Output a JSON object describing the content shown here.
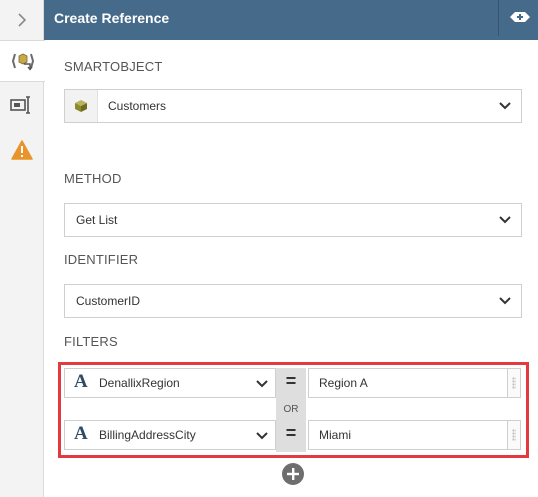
{
  "header": {
    "title": "Create Reference"
  },
  "rail": {
    "items": [
      {
        "icon": "chevron-right-icon"
      },
      {
        "icon": "smartobject-icon"
      },
      {
        "icon": "controls-icon"
      },
      {
        "icon": "warning-icon"
      }
    ]
  },
  "smartobject": {
    "label": "SMARTOBJECT",
    "value": "Customers"
  },
  "method": {
    "label": "METHOD",
    "value": "Get List"
  },
  "identifier": {
    "label": "IDENTIFIER",
    "value": "CustomerID"
  },
  "filters": {
    "label": "FILTERS",
    "rows": [
      {
        "field": "DenallixRegion",
        "type_letter": "A",
        "operator": "=",
        "value": "Region A"
      },
      {
        "field": "BillingAddressCity",
        "type_letter": "A",
        "operator": "=",
        "value": "Miami"
      }
    ],
    "join": "OR"
  },
  "colors": {
    "header_bg": "#466a89",
    "highlight_border": "#e23a3f",
    "warning": "#e8942a",
    "smartobject_icon": "#8c8a2e"
  }
}
